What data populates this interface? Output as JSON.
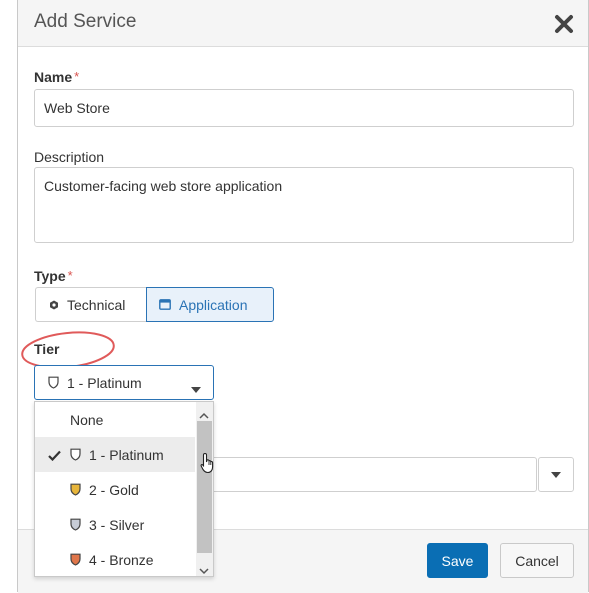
{
  "dialog": {
    "title": "Add Service",
    "close_icon": "close-icon"
  },
  "form": {
    "name": {
      "label": "Name",
      "required_mark": "*",
      "value": "Web Store"
    },
    "description": {
      "label": "Description",
      "value": "Customer-facing web store application"
    },
    "type": {
      "label": "Type",
      "required_mark": "*",
      "options": [
        {
          "label": "Technical",
          "icon": "technical-icon",
          "selected": false
        },
        {
          "label": "Application",
          "icon": "application-icon",
          "selected": true
        }
      ]
    },
    "tier": {
      "label": "Tier",
      "selected_label": "1 - Platinum",
      "selected_icon": "shield-outline-icon",
      "options": [
        {
          "label": "None",
          "icon": "",
          "color": ""
        },
        {
          "label": "1 - Platinum",
          "icon": "shield-outline-icon",
          "color": "#ffffff",
          "selected": true
        },
        {
          "label": "2 - Gold",
          "icon": "shield-gold-icon",
          "color": "#e7b53a"
        },
        {
          "label": "3 - Silver",
          "icon": "shield-silver-icon",
          "color": "#c7ccd6"
        },
        {
          "label": "4 - Bronze",
          "icon": "shield-bronze-icon",
          "color": "#e0764a"
        }
      ]
    }
  },
  "footer": {
    "save_label": "Save",
    "cancel_label": "Cancel"
  },
  "colors": {
    "accent": "#2a73b5",
    "save_button": "#0a6eb4",
    "required": "#d9534f",
    "annotation": "#e05a5a"
  }
}
